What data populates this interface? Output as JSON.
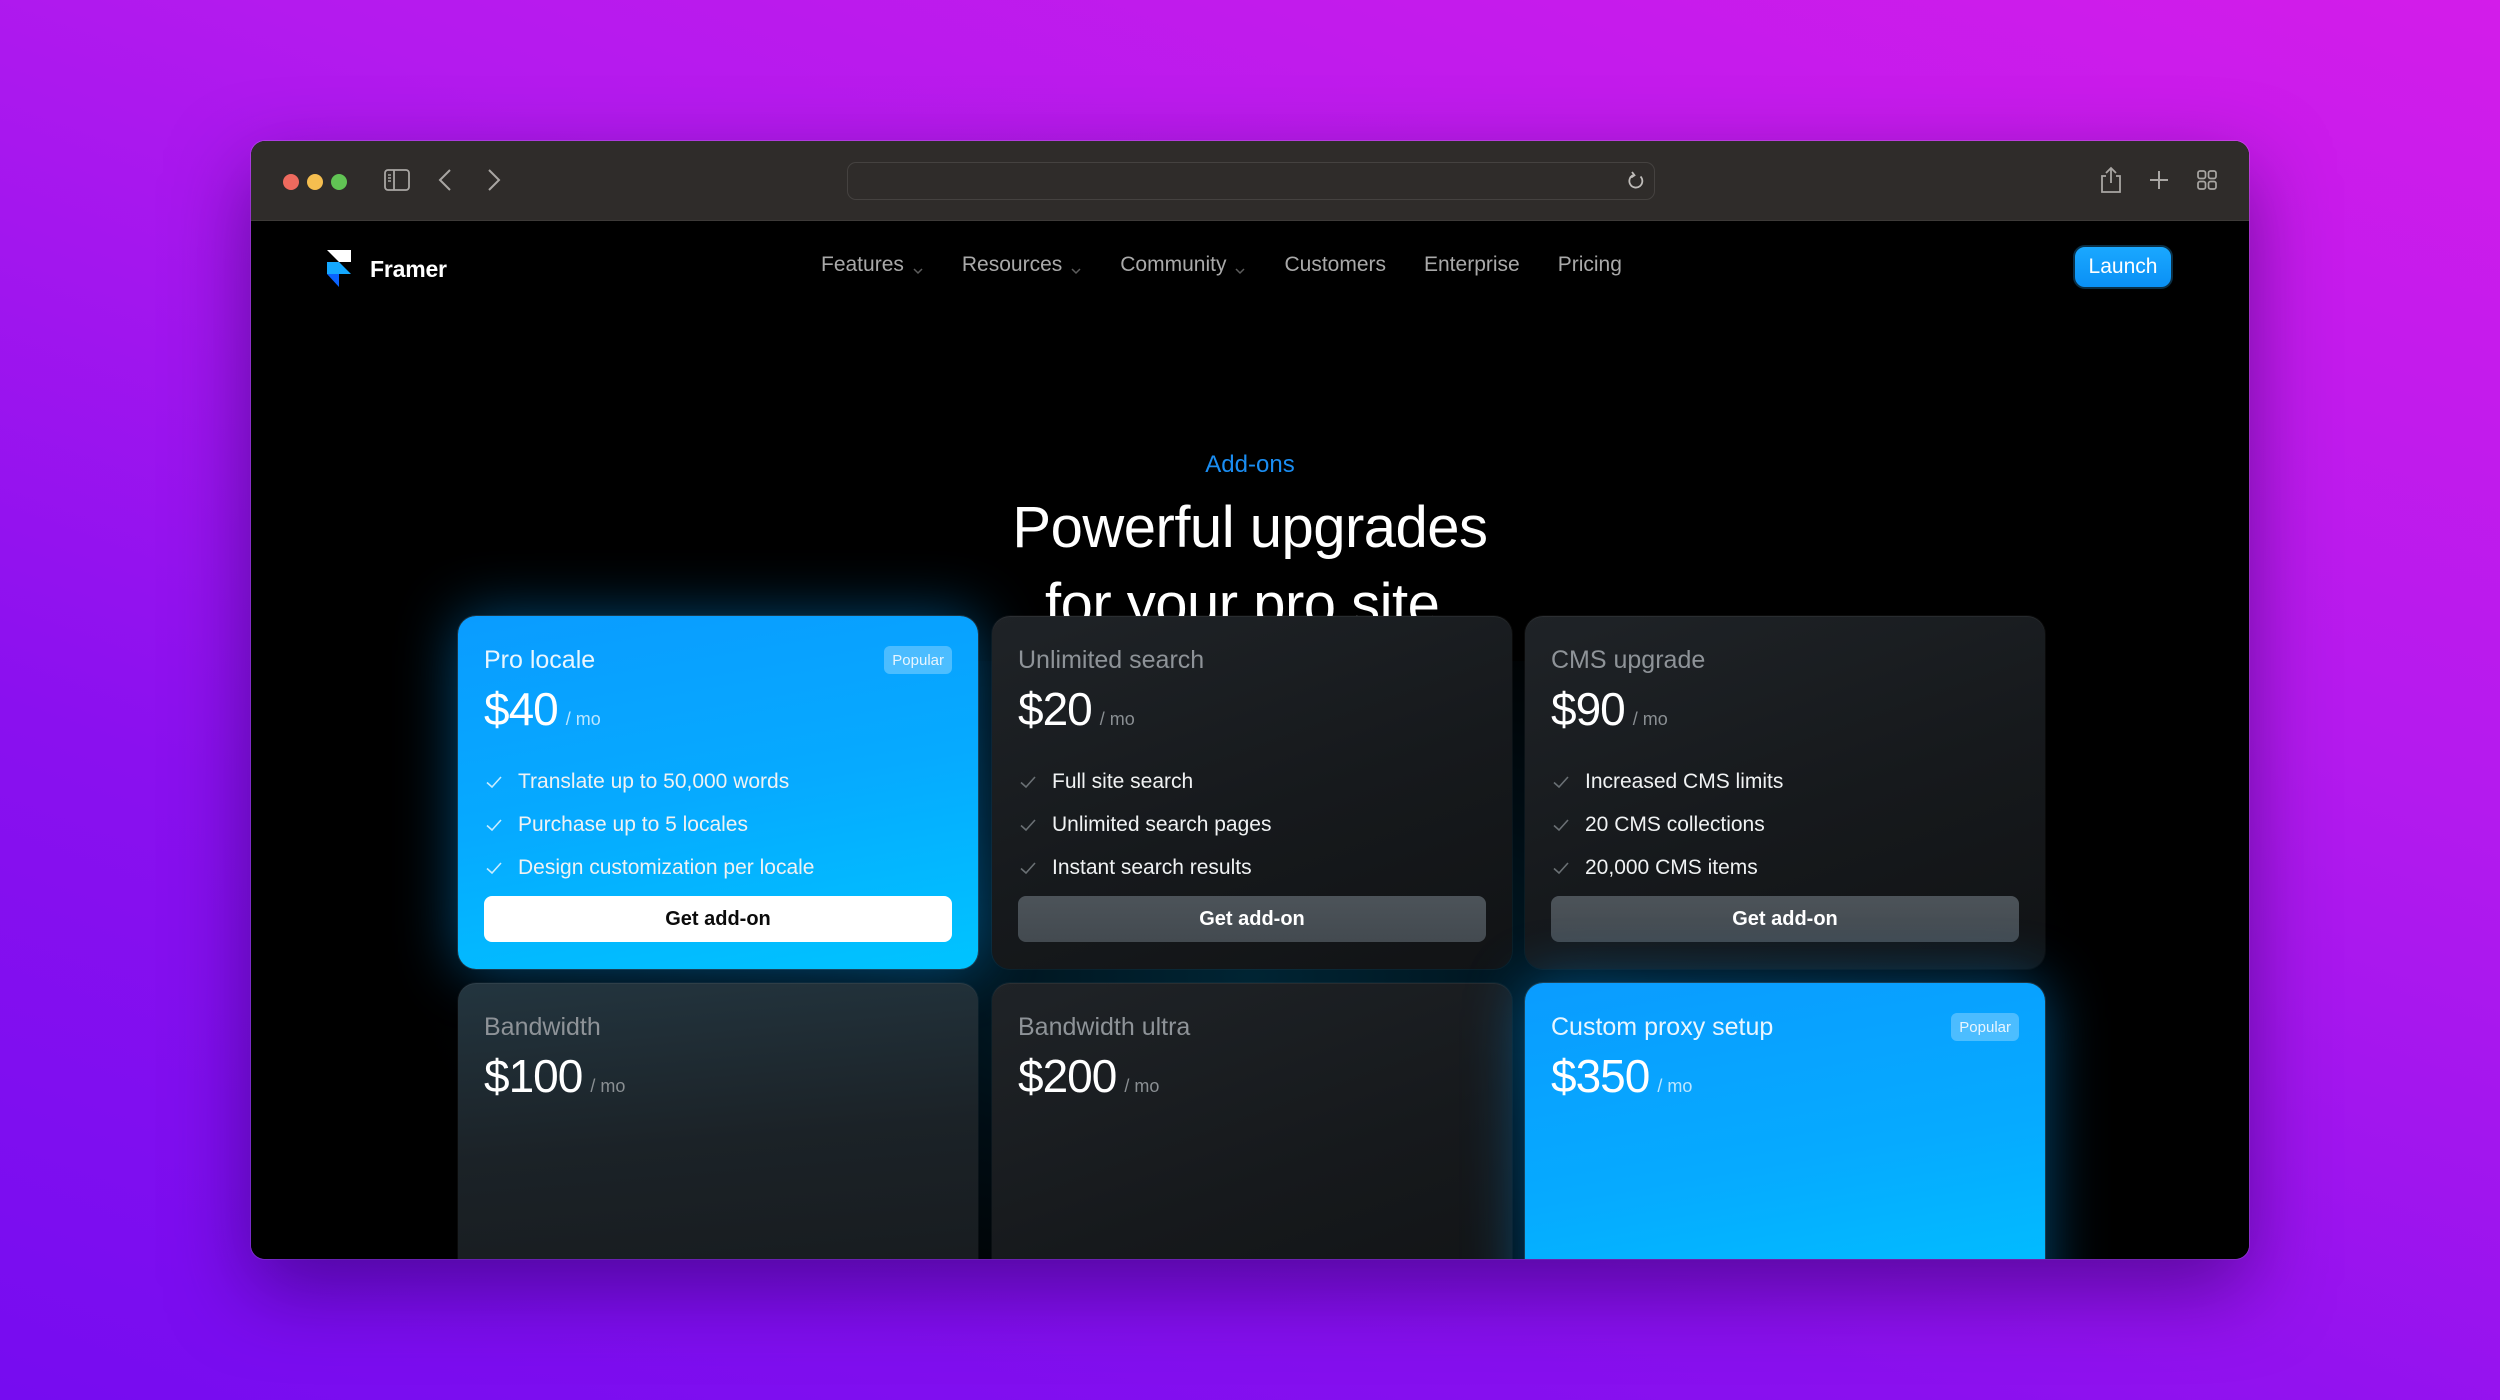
{
  "browser": {
    "url": "",
    "icons": [
      "sidebar-icon",
      "back-icon",
      "forward-icon",
      "reload-icon",
      "share-icon",
      "new-tab-icon",
      "tab-overview-icon"
    ]
  },
  "site": {
    "brand": "Framer",
    "nav": [
      {
        "label": "Features",
        "dropdown": true
      },
      {
        "label": "Resources",
        "dropdown": true
      },
      {
        "label": "Community",
        "dropdown": true
      },
      {
        "label": "Customers",
        "dropdown": false
      },
      {
        "label": "Enterprise",
        "dropdown": false
      },
      {
        "label": "Pricing",
        "dropdown": false
      }
    ],
    "launch_label": "Launch"
  },
  "hero": {
    "eyebrow": "Add-ons",
    "title_line1": "Powerful upgrades",
    "title_line2": "for your pro site."
  },
  "colors": {
    "accent": "#0a9cff",
    "eyebrow": "#1a8df2",
    "background_top": "#d31cea",
    "background_bottom": "#760cf0"
  },
  "addons": [
    {
      "title": "Pro locale",
      "price": "$40",
      "period": "/ mo",
      "badge": "Popular",
      "featured": true,
      "features": [
        "Translate up to 50,000 words",
        "Purchase up to 5 locales",
        "Design customization per locale"
      ],
      "cta": "Get add-on"
    },
    {
      "title": "Unlimited search",
      "price": "$20",
      "period": "/ mo",
      "badge": null,
      "featured": false,
      "features": [
        "Full site search",
        "Unlimited search pages",
        "Instant search results"
      ],
      "cta": "Get add-on"
    },
    {
      "title": "CMS upgrade",
      "price": "$90",
      "period": "/ mo",
      "badge": null,
      "featured": false,
      "features": [
        "Increased CMS limits",
        "20 CMS collections",
        "20,000 CMS items"
      ],
      "cta": "Get add-on"
    },
    {
      "title": "Bandwidth",
      "price": "$100",
      "period": "/ mo",
      "badge": null,
      "featured": false
    },
    {
      "title": "Bandwidth ultra",
      "price": "$200",
      "period": "/ mo",
      "badge": null,
      "featured": false
    },
    {
      "title": "Custom proxy setup",
      "price": "$350",
      "period": "/ mo",
      "badge": "Popular",
      "featured": true
    }
  ]
}
